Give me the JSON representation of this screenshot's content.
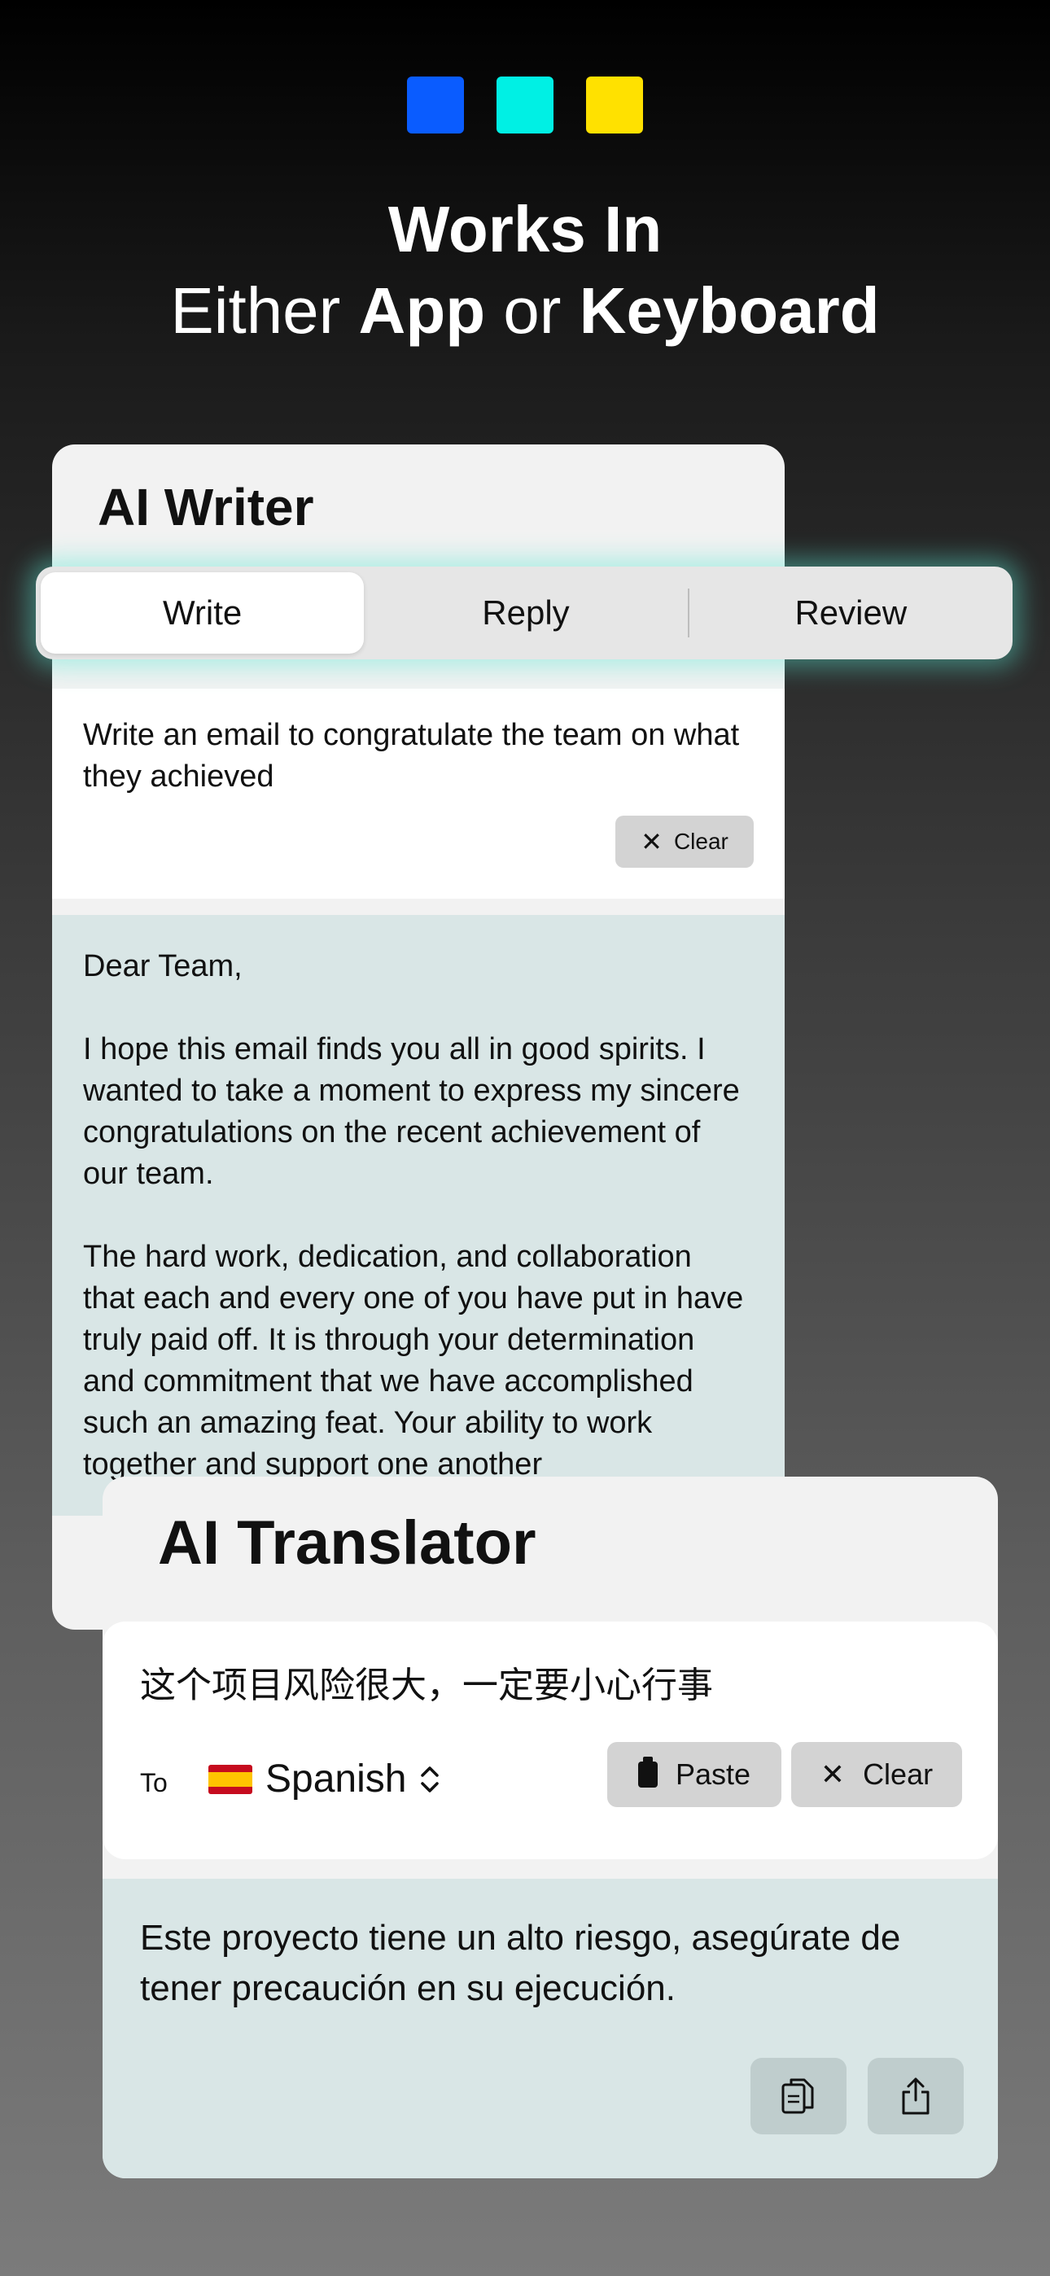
{
  "colors": {
    "square_blue": "#0a5cff",
    "square_cyan": "#00f0e4",
    "square_yellow": "#ffe100",
    "accent_glow": "#5ae6d2"
  },
  "headline": {
    "line1": "Works In",
    "either": "Either",
    "app": "App",
    "or": "or",
    "keyboard": "Keyboard"
  },
  "writer": {
    "title": "AI Writer",
    "tabs": [
      {
        "label": "Write",
        "selected": true
      },
      {
        "label": "Reply",
        "selected": false
      },
      {
        "label": "Review",
        "selected": false
      }
    ],
    "prompt": "Write an email to congratulate the team on what they achieved",
    "clear_label": "Clear",
    "result": "Dear Team,\n\nI hope this email finds you all in good spirits. I wanted to take a moment to express my sincere congratulations on the recent achievement of our team.\n\nThe hard work, dedication, and collaboration that each and every one of you have put in have truly paid off. It is through your determination and commitment that we have accomplished such an amazing feat. Your ability to work together and support one another"
  },
  "translator": {
    "title": "AI Translator",
    "source_text": "这个项目风险很大，一定要小心行事",
    "to_label": "To",
    "language": "Spanish",
    "paste_label": "Paste",
    "clear_label": "Clear",
    "output": "Este proyecto tiene un alto riesgo, asegúrate de tener precaución en su ejecución."
  }
}
